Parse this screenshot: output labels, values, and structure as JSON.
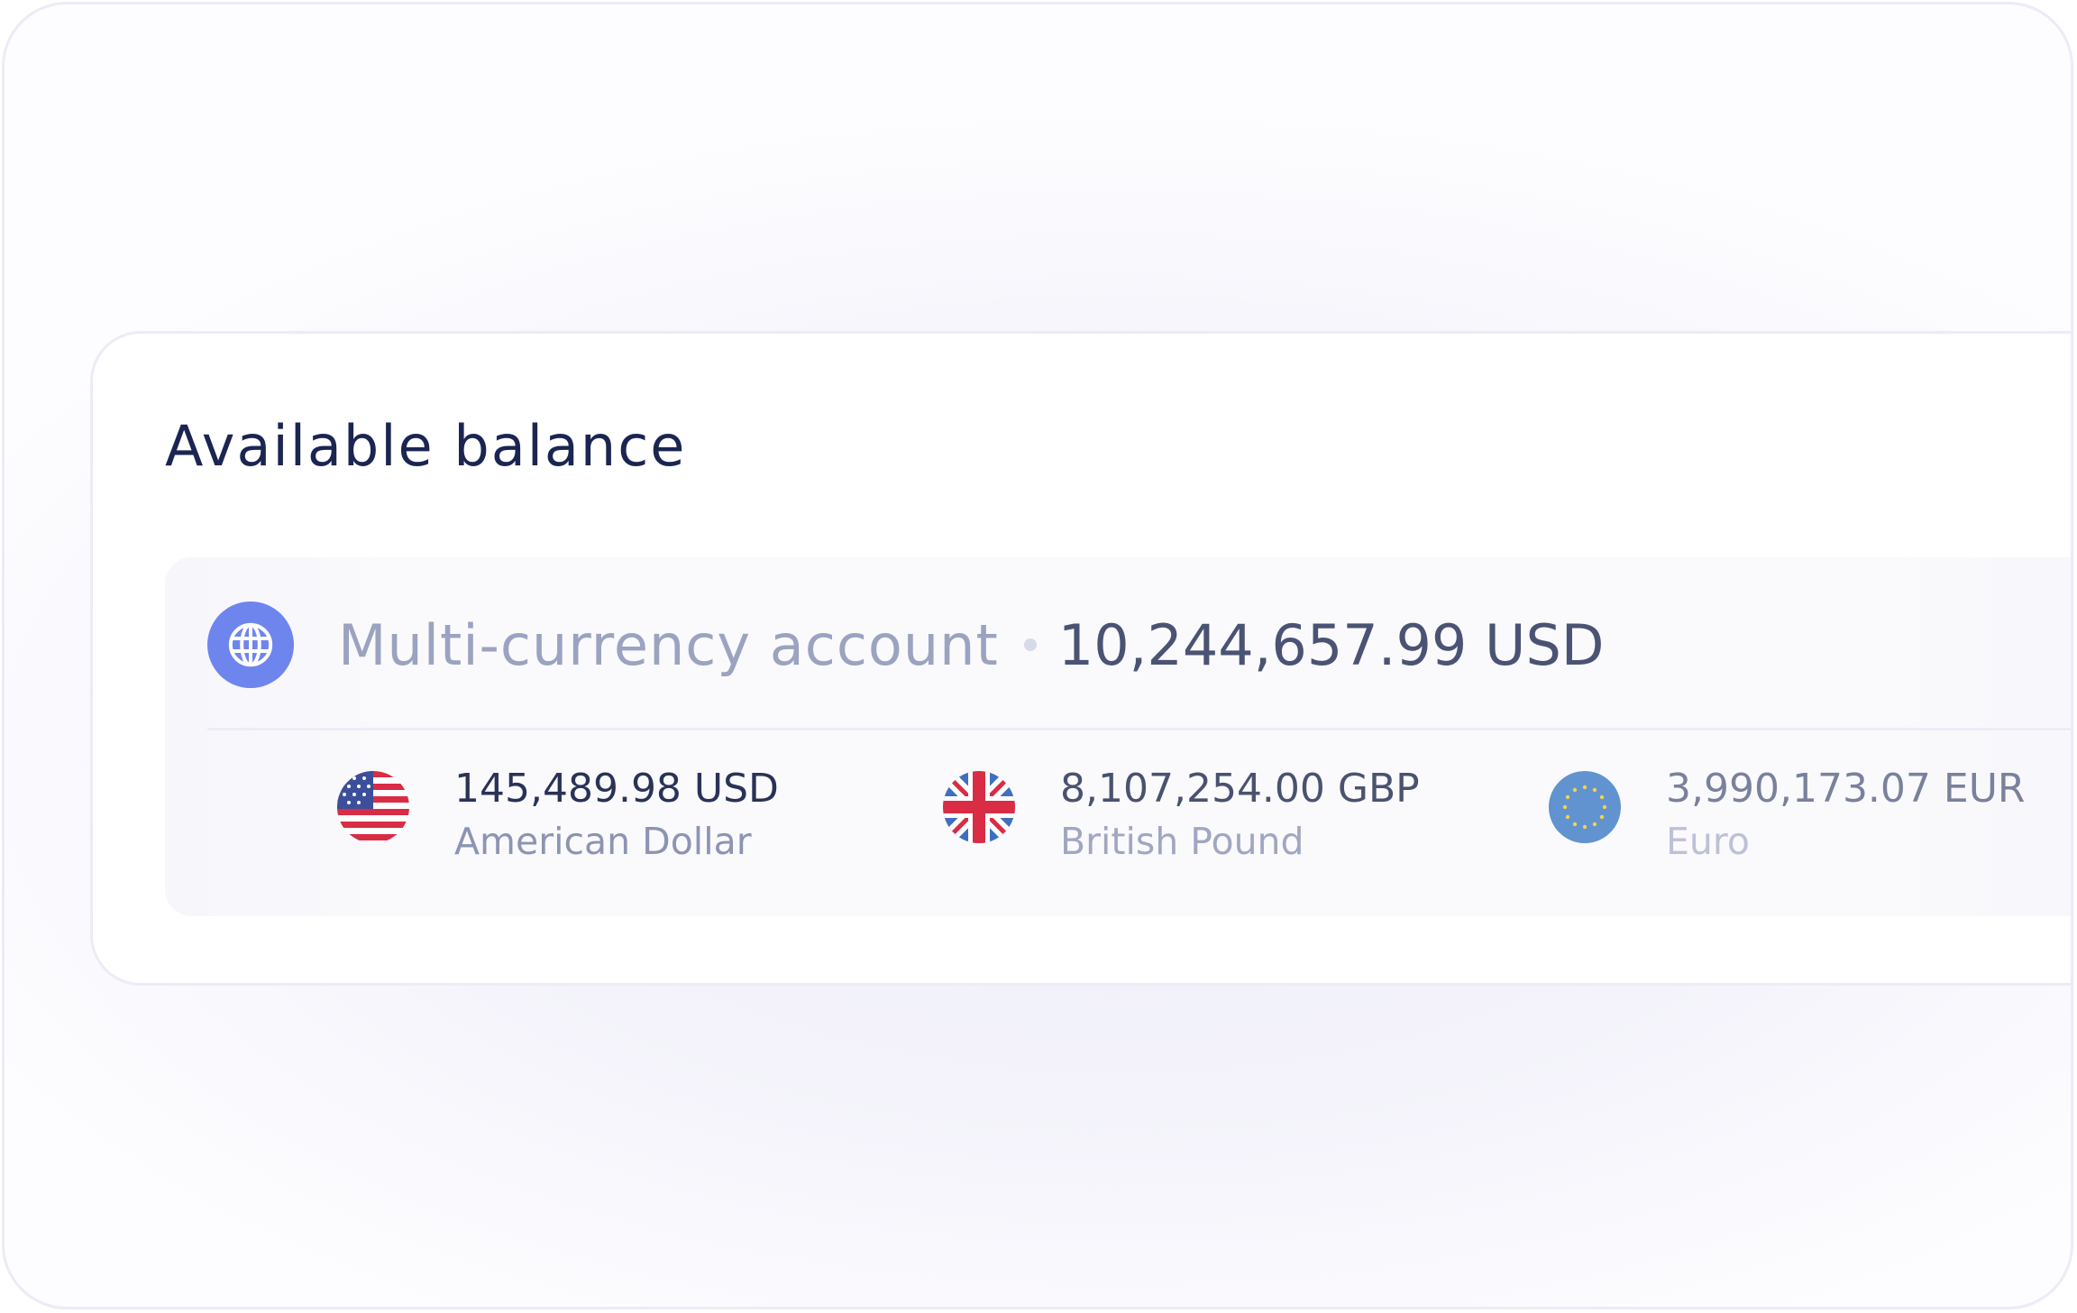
{
  "balance": {
    "title": "Available balance",
    "account": {
      "name": "Multi-currency account",
      "total": "10,244,657.99 USD",
      "icon": "globe-icon",
      "icon_color": "#6f85ee"
    },
    "currencies": [
      {
        "amount": "145,489.98 USD",
        "name": "American Dollar",
        "icon": "us-flag-icon",
        "amount_color": "#2a3257",
        "name_color": "#8d94b3"
      },
      {
        "amount": "8,107,254.00 GBP",
        "name": "British Pound",
        "icon": "uk-flag-icon",
        "amount_color": "#4a5270",
        "name_color": "#a1a7c2"
      },
      {
        "amount": "3,990,173.07 EUR",
        "name": "Euro",
        "icon": "eu-flag-icon",
        "amount_color": "#7a819d",
        "name_color": "#bcc1d6"
      }
    ]
  },
  "colors": {
    "title": "#1b2552",
    "accent": "#6f85ee"
  }
}
